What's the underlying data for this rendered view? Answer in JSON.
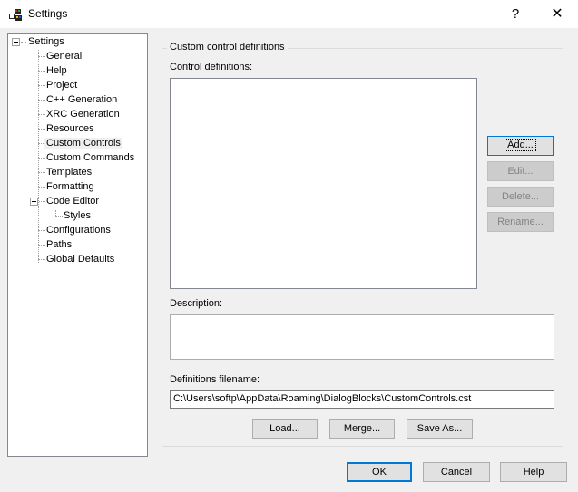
{
  "window": {
    "title": "Settings",
    "help_glyph": "?",
    "close_glyph": "✕"
  },
  "tree": {
    "root": "Settings",
    "items": [
      "General",
      "Help",
      "Project",
      "C++ Generation",
      "XRC Generation",
      "Resources",
      "Custom Controls",
      "Custom Commands",
      "Templates",
      "Formatting",
      "Code Editor",
      "Styles",
      "Configurations",
      "Paths",
      "Global Defaults"
    ],
    "selected": "Custom Controls"
  },
  "panel": {
    "group_title": "Custom control definitions",
    "list_label": "Control definitions:",
    "description_label": "Description:",
    "filename_label": "Definitions filename:",
    "filename_value": "C:\\Users\\softp\\AppData\\Roaming\\DialogBlocks\\CustomControls.cst"
  },
  "side_buttons": {
    "add": "Add...",
    "edit": "Edit...",
    "delete": "Delete...",
    "rename": "Rename..."
  },
  "file_buttons": {
    "load": "Load...",
    "merge": "Merge...",
    "save_as": "Save As..."
  },
  "dialog_buttons": {
    "ok": "OK",
    "cancel": "Cancel",
    "help": "Help"
  },
  "colors": {
    "accent": "#0078d7",
    "tree_border": "#828790"
  }
}
